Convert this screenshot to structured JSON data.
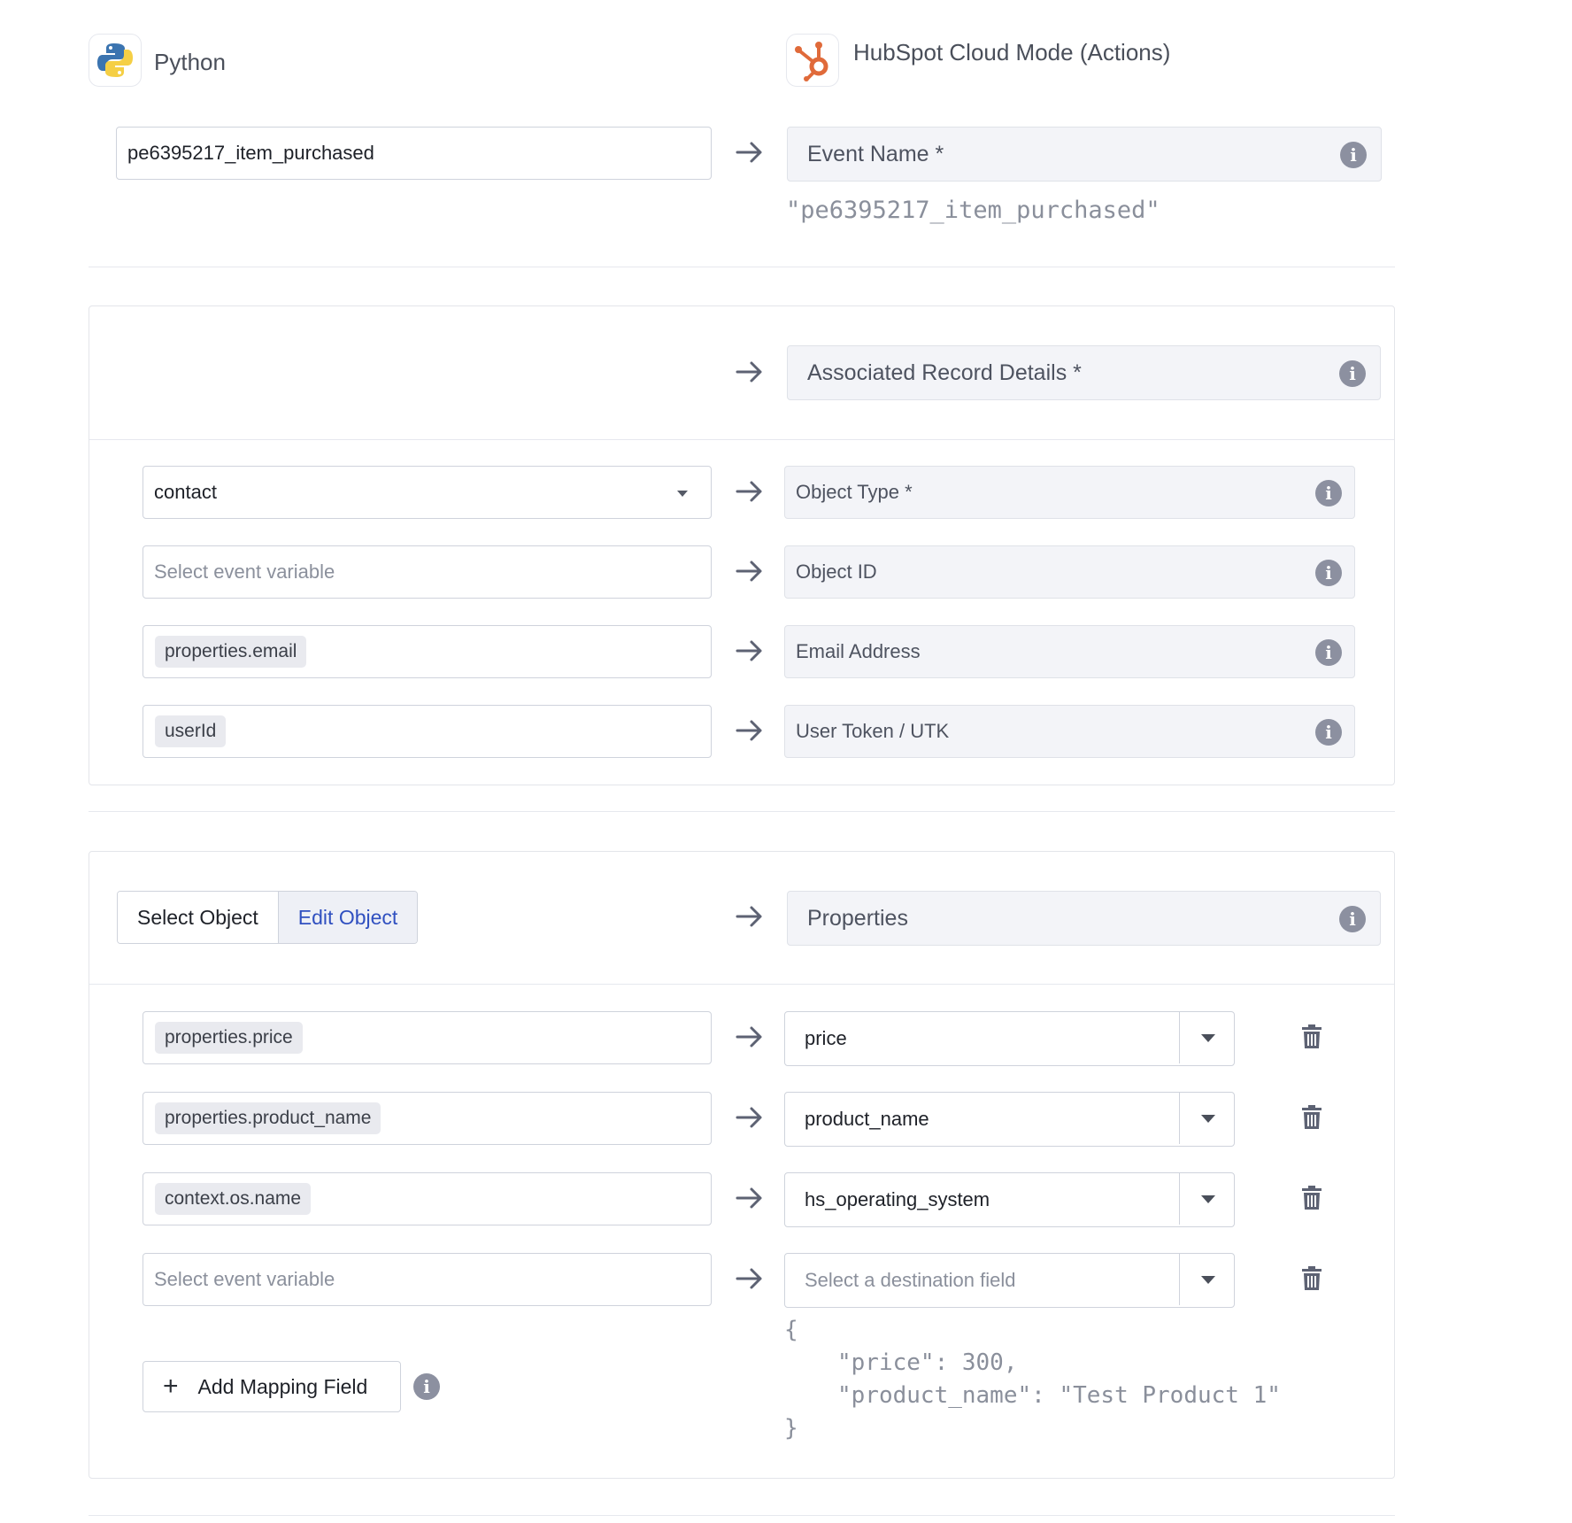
{
  "source": {
    "name": "Python",
    "icon": "python-logo-icon"
  },
  "destination": {
    "name": "HubSpot Cloud Mode (Actions)",
    "icon": "hubspot-logo-icon"
  },
  "event": {
    "source_value": "pe6395217_item_purchased",
    "target_label": "Event Name *",
    "preview": "\"pe6395217_item_purchased\""
  },
  "associated": {
    "header_label": "Associated Record Details *",
    "rows": [
      {
        "source_value": "contact",
        "source_kind": "select",
        "target_label": "Object Type *"
      },
      {
        "source_placeholder": "Select event variable",
        "source_kind": "empty",
        "target_label": "Object ID"
      },
      {
        "source_chip": "properties.email",
        "source_kind": "chip",
        "target_label": "Email Address"
      },
      {
        "source_chip": "userId",
        "source_kind": "chip",
        "target_label": "User Token / UTK"
      }
    ]
  },
  "properties": {
    "segmented": {
      "select_label": "Select Object",
      "edit_label": "Edit Object",
      "active": "Edit Object"
    },
    "header_label": "Properties",
    "rows": [
      {
        "source_chip": "properties.price",
        "target_value": "price"
      },
      {
        "source_chip": "properties.product_name",
        "target_value": "product_name"
      },
      {
        "source_chip": "context.os.name",
        "target_value": "hs_operating_system"
      },
      {
        "source_placeholder": "Select event variable",
        "target_placeholder": "Select a destination field"
      }
    ],
    "add_button_label": "Add Mapping Field",
    "preview": {
      "open": "{",
      "line1": "\"price\": 300,",
      "line2": "\"product_name\": \"Test Product 1\"",
      "close": "}"
    }
  },
  "info_glyph": "i",
  "colors": {
    "accent": "#3050c0",
    "hubspot": "#e06a3a",
    "python_blue": "#3b74b0",
    "python_yellow": "#f5cf45"
  }
}
